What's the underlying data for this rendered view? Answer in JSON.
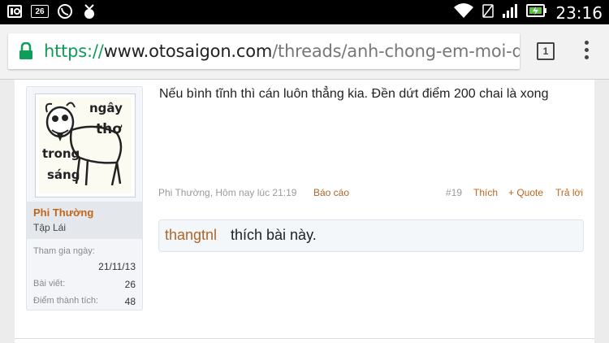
{
  "status_bar": {
    "left_icons": [
      "photo-notification-icon",
      "26-notification-icon",
      "viber-icon",
      "download-icon"
    ],
    "badge_text": "26",
    "time": "23:16",
    "right_icons": [
      "wifi-icon",
      "no-sim-icon",
      "signal-icon",
      "battery-charging-icon"
    ]
  },
  "browser": {
    "url_scheme": "https://",
    "url_host": "www.otosaigon.com",
    "url_path": "/threads/anh-chong-em-moi-dung-ch",
    "tab_count": "1",
    "scheme_color": "#0f9d58"
  },
  "user": {
    "avatar_words": [
      "ngây",
      "thơ",
      "trong",
      "sáng"
    ],
    "name": "Phi Thường",
    "title": "Tập Lái",
    "stats": [
      {
        "label": "Tham gia ngày:",
        "value": "21/11/13"
      },
      {
        "label": "Bài viết:",
        "value": "26"
      },
      {
        "label": "Điểm thành tích:",
        "value": "48"
      }
    ]
  },
  "post": {
    "text": "Nếu bình tĩnh thì cán luôn thẳng kia. Đền dứt điểm 200 chai là xong",
    "meta": "Phi Thường, Hôm nay lúc 21:19",
    "report": "Báo cáo",
    "number": "#19",
    "actions": {
      "like": "Thích",
      "quote": "+ Quote",
      "reply": "Trả lời"
    },
    "likes": {
      "user": "thangtnl",
      "text": "thích bài này."
    },
    "accent_color": "#c0661c"
  }
}
